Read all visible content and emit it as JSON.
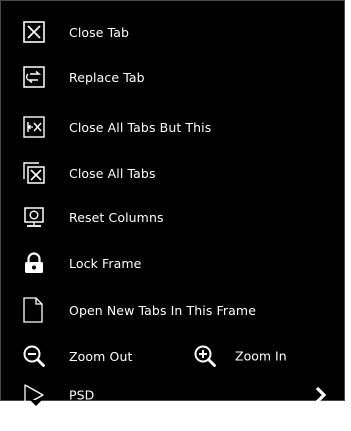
{
  "menu": {
    "items": [
      {
        "label": "Close Tab",
        "icon": "close-tab-icon"
      },
      {
        "label": "Replace Tab",
        "icon": "replace-tab-icon"
      },
      {
        "label": "Close All Tabs But This",
        "icon": "close-others-icon"
      },
      {
        "label": "Close All Tabs",
        "icon": "close-all-tabs-icon"
      },
      {
        "label": "Reset Columns",
        "icon": "reset-columns-icon"
      },
      {
        "label": "Lock Frame",
        "icon": "lock-icon"
      },
      {
        "label": "Open New Tabs In This Frame",
        "icon": "new-document-icon"
      },
      {
        "label": "Zoom Out",
        "icon": "zoom-out-icon"
      },
      {
        "label": "PSD",
        "icon": "play-icon"
      }
    ],
    "zoom_in": {
      "label": "Zoom In",
      "icon": "zoom-in-icon"
    },
    "submenu_indicator": "chevron-right-icon"
  },
  "colors": {
    "background": "#000000",
    "text": "#ffffff",
    "icon": "#ffffff"
  }
}
